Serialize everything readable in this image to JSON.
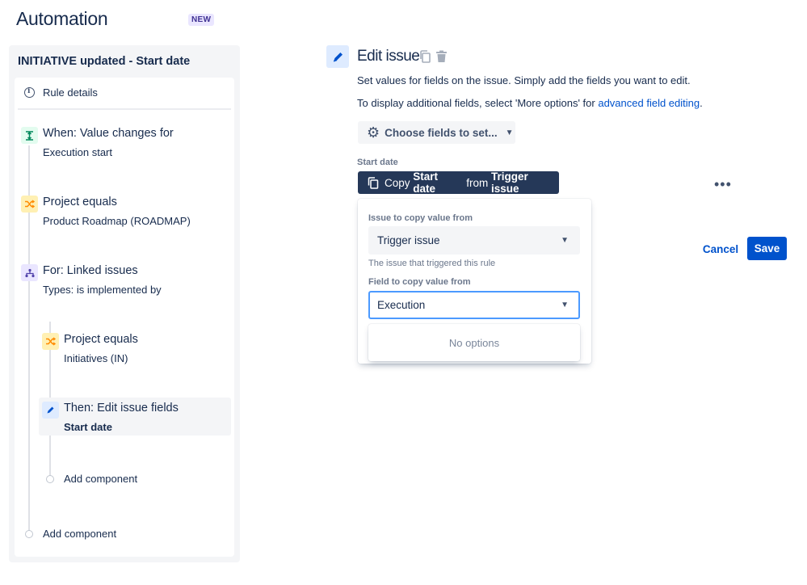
{
  "header": {
    "title": "Automation",
    "badge": "NEW"
  },
  "rule": {
    "name": "INITIATIVE updated - Start date",
    "details_label": "Rule details",
    "steps": [
      {
        "type": "trigger",
        "icon": "trigger-icon",
        "title": "When: Value changes for",
        "subtitle": "Execution start"
      },
      {
        "type": "condition",
        "icon": "condition-icon",
        "title": "Project equals",
        "subtitle": "Product Roadmap (ROADMAP)"
      },
      {
        "type": "branch",
        "icon": "branch-icon",
        "title": "For: Linked issues",
        "subtitle": "Types: is implemented by"
      },
      {
        "type": "condition",
        "icon": "condition-icon",
        "title": "Project equals",
        "subtitle": "Initiatives (IN)"
      },
      {
        "type": "action",
        "icon": "pencil-icon",
        "title": "Then: Edit issue fields",
        "subtitle": "Start date"
      }
    ],
    "add_component_inner": "Add component",
    "add_component_outer": "Add component"
  },
  "editor": {
    "title": "Edit issue",
    "description": "Set values for fields on the issue. Simply add the fields you want to edit.",
    "more_prefix": "To display additional fields, select 'More options' for ",
    "more_link": "advanced field editing",
    "more_suffix": ".",
    "choose_fields": "Choose fields to set...",
    "field_label": "Start date",
    "copy_button": {
      "pre": "Copy ",
      "field": "Start date",
      "mid": " from ",
      "source": "Trigger issue"
    },
    "popup": {
      "issue_label": "Issue to copy value from",
      "issue_value": "Trigger issue",
      "issue_help": "The issue that triggered this rule",
      "field_label": "Field to copy value from",
      "field_value": "Execution",
      "no_options": "No options"
    },
    "cancel": "Cancel",
    "save": "Save"
  },
  "colors": {
    "primary": "#0052CC",
    "dark_button": "#253858",
    "focus_border": "#4C9AFF"
  }
}
